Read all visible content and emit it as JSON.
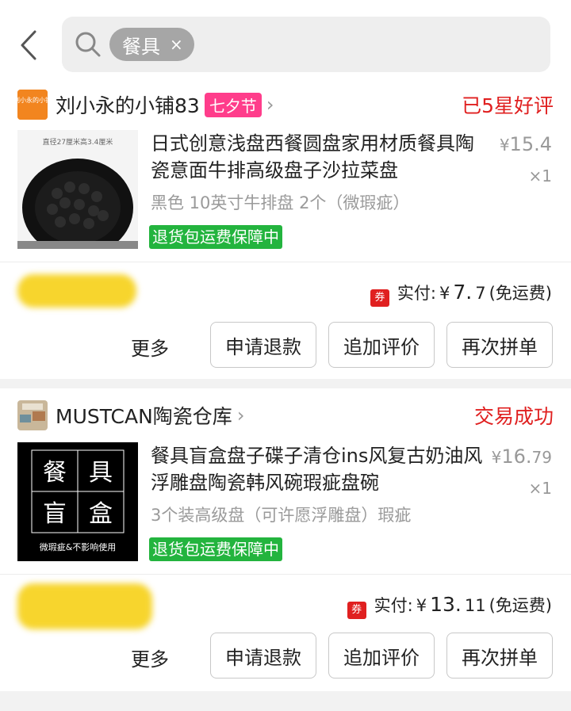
{
  "search": {
    "chip_label": "餐具",
    "chip_clear": "×"
  },
  "orders": [
    {
      "shop_name": "刘小永的小铺83",
      "shop_logo_text": "刘小永的小铺",
      "festival_tag": "七夕节",
      "status": "已5星好评",
      "thumb_caption": "直径27厘米高3.4厘米",
      "title": "日式创意浅盘西餐圆盘家用材质餐具陶瓷意面牛排高级盘子沙拉菜盘",
      "spec": "黑色 10英寸牛排盘 2个（微瑕疵）",
      "badge": "退货包运费保障中",
      "price_symbol": "¥",
      "price_int": "15.",
      "price_dec": "4",
      "qty": "×1",
      "coupon": "券",
      "paid_label": "实付:",
      "paid_symbol": "¥",
      "paid_int": "7.",
      "paid_dec": "7",
      "shipping": "(免运费)",
      "more": "更多",
      "actions": [
        "申请退款",
        "追加评价",
        "再次拼单"
      ]
    },
    {
      "shop_name": "MUSTCAN陶瓷仓库",
      "status": "交易成功",
      "thumb_chars": [
        "餐",
        "具",
        "盲",
        "盒"
      ],
      "thumb_caption": "微瑕疵&不影响使用",
      "title": "餐具盲盒盘子碟子清仓ins风复古奶油风浮雕盘陶瓷韩风碗瑕疵盘碗",
      "spec": "3个装高级盘（可许愿浮雕盘）瑕疵",
      "badge": "退货包运费保障中",
      "price_symbol": "¥",
      "price_int": "16.",
      "price_dec": "79",
      "qty": "×1",
      "coupon": "券",
      "paid_label": "实付:",
      "paid_symbol": "¥",
      "paid_int": "13.",
      "paid_dec": "11",
      "shipping": "(免运费)",
      "more": "更多",
      "actions": [
        "申请退款",
        "追加评价",
        "再次拼单"
      ]
    }
  ],
  "colors": {
    "status_red": "#e02020",
    "badge_green": "#23b43e",
    "festival_pink": "#ff3d8b",
    "search_bg": "#eeeeee"
  },
  "icons": {
    "back": "chevron-left-icon",
    "search": "search-icon",
    "shop_arrow": "chevron-right-icon"
  }
}
